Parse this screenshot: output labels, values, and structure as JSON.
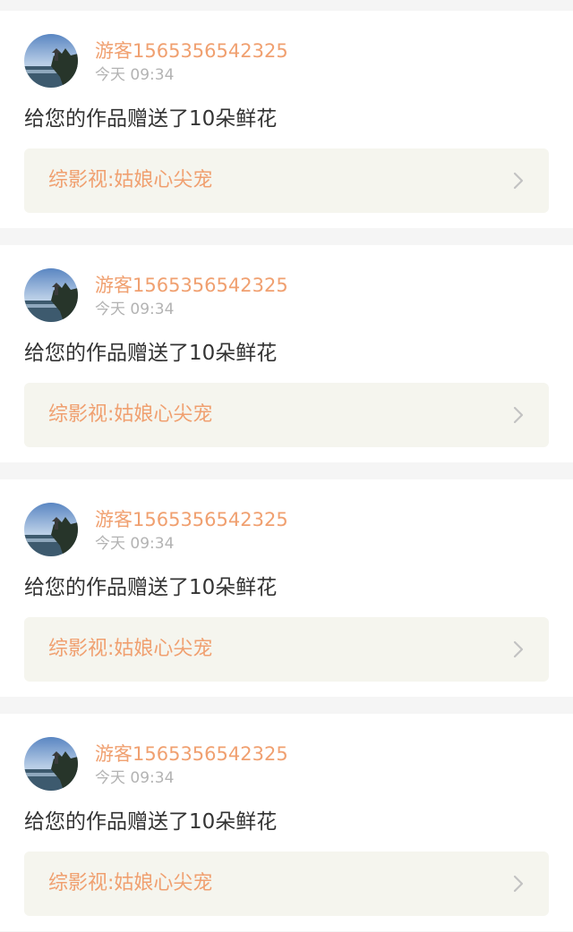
{
  "colors": {
    "accent": "#f0a070",
    "text": "#333333",
    "muted": "#b3b3b3",
    "link_bg": "#f5f5ee",
    "page_bg": "#f5f5f5"
  },
  "notifications": [
    {
      "user": "游客1565356542325",
      "time": "今天 09:34",
      "message": "给您的作品赠送了10朵鲜花",
      "work_title": "综影视:姑娘心尖宠",
      "avatar_icon": "avatar-icon",
      "arrow_icon": "chevron-right-icon"
    },
    {
      "user": "游客1565356542325",
      "time": "今天 09:34",
      "message": "给您的作品赠送了10朵鲜花",
      "work_title": "综影视:姑娘心尖宠",
      "avatar_icon": "avatar-icon",
      "arrow_icon": "chevron-right-icon"
    },
    {
      "user": "游客1565356542325",
      "time": "今天 09:34",
      "message": "给您的作品赠送了10朵鲜花",
      "work_title": "综影视:姑娘心尖宠",
      "avatar_icon": "avatar-icon",
      "arrow_icon": "chevron-right-icon"
    },
    {
      "user": "游客1565356542325",
      "time": "今天 09:34",
      "message": "给您的作品赠送了10朵鲜花",
      "work_title": "综影视:姑娘心尖宠",
      "avatar_icon": "avatar-icon",
      "arrow_icon": "chevron-right-icon"
    }
  ]
}
